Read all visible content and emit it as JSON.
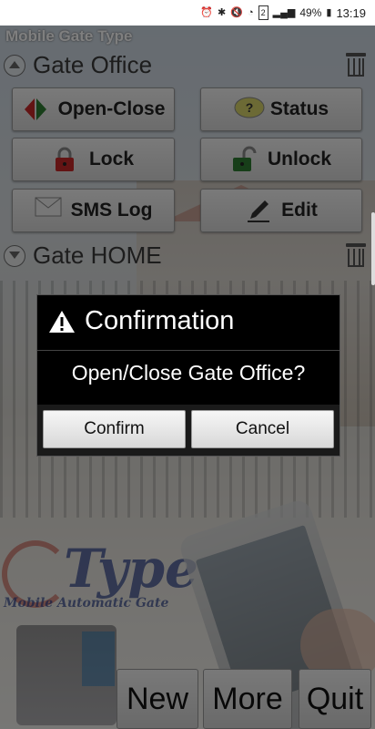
{
  "status_bar": {
    "battery": "49%",
    "time": "13:19",
    "icons": [
      "alarm-icon",
      "bluetooth-icon",
      "mute-icon",
      "wifi-icon",
      "sim2-icon",
      "signal-icon",
      "battery-icon"
    ],
    "sim_label": "2"
  },
  "app": {
    "title": "Mobile Gate Type"
  },
  "gates": [
    {
      "name": "Gate Office",
      "buttons": {
        "open_close": "Open-Close",
        "status": "Status",
        "lock": "Lock",
        "unlock": "Unlock",
        "sms_log": "SMS Log",
        "edit": "Edit"
      },
      "status_icon_text": "?"
    },
    {
      "name": "Gate HOME"
    }
  ],
  "background": {
    "logo_text": "Type",
    "logo_subtitle": "Mobile Automatic Gate"
  },
  "bottom_bar": {
    "new": "New",
    "more": "More",
    "quit": "Quit"
  },
  "dialog": {
    "title": "Confirmation",
    "message": "Open/Close Gate Office?",
    "confirm": "Confirm",
    "cancel": "Cancel"
  },
  "colors": {
    "dialog_bg": "#000000",
    "dim_overlay": "rgba(0,0,0,0.5)",
    "logo_blue": "#2a3f8a",
    "lock_red": "#c62828",
    "unlock_green": "#2e7d32"
  }
}
